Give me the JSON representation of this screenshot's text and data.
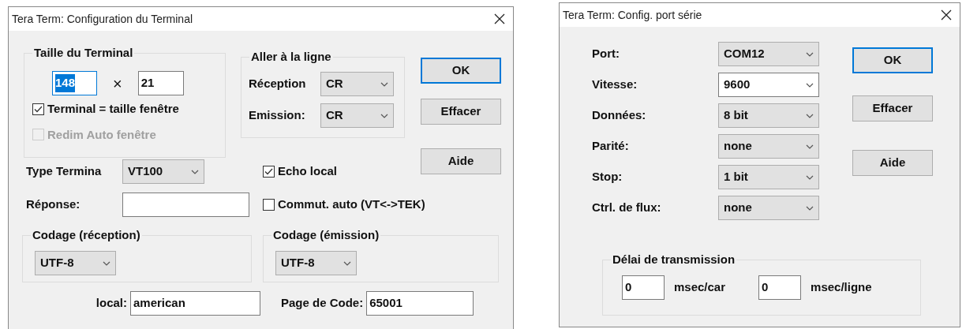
{
  "terminal_dialog": {
    "title": "Tera Term: Configuration du Terminal",
    "size_group": {
      "label": "Taille du Terminal",
      "columns": {
        "value": "148",
        "text_selected": true
      },
      "times": "×",
      "rows": {
        "value": "21",
        "text_selected": false
      },
      "checkboxes": [
        {
          "label": "Terminal = taille fenêtre",
          "checked": true,
          "disabled": false
        },
        {
          "label": "Redim Auto fenêtre",
          "checked": false,
          "disabled": true
        }
      ]
    },
    "newline_group": {
      "label": "Aller à la ligne",
      "fields": [
        {
          "label": "Réception",
          "value": "CR"
        },
        {
          "label": "Emission:",
          "value": "CR"
        }
      ]
    },
    "buttons": [
      {
        "label": "OK",
        "focused": true
      },
      {
        "label": "Effacer",
        "focused": false
      },
      {
        "label": "Aide",
        "focused": false
      }
    ],
    "terminal_type": {
      "label": "Type Termina",
      "value": "VT100"
    },
    "echo_local": {
      "label": "Echo local",
      "checked": true,
      "disabled": false
    },
    "reply": {
      "label": "Réponse:"
    },
    "auto_switch": {
      "label": "Commut. auto (VT<->TEK)",
      "checked": false,
      "disabled": false
    },
    "encoding_groups": [
      {
        "label": "Codage (réception)",
        "value": "UTF-8"
      },
      {
        "label": "Codage (émission)",
        "value": "UTF-8"
      }
    ],
    "locale": {
      "label": "local:",
      "value": "american"
    },
    "code_page": {
      "label": "Page de Code:",
      "value": "65001"
    }
  },
  "serial_dialog": {
    "title": "Tera Term: Config. port série",
    "fields": [
      {
        "label": "Port:",
        "value": "COM12",
        "editable": false
      },
      {
        "label": "Vitesse:",
        "value": "9600",
        "editable": true
      },
      {
        "label": "Données:",
        "value": "8 bit",
        "editable": false
      },
      {
        "label": "Parité:",
        "value": "none",
        "editable": false
      },
      {
        "label": "Stop:",
        "value": "1 bit",
        "editable": false
      },
      {
        "label": "Ctrl. de flux:",
        "value": "none",
        "editable": false
      }
    ],
    "buttons": [
      {
        "label": "OK",
        "focused": true
      },
      {
        "label": "Effacer",
        "focused": false
      },
      {
        "label": "Aide",
        "focused": false
      }
    ],
    "delay_group": {
      "label": "Délai de transmission",
      "fields": [
        {
          "value": "0",
          "unit": "msec/car"
        },
        {
          "value": "0",
          "unit": "msec/ligne"
        }
      ]
    }
  }
}
